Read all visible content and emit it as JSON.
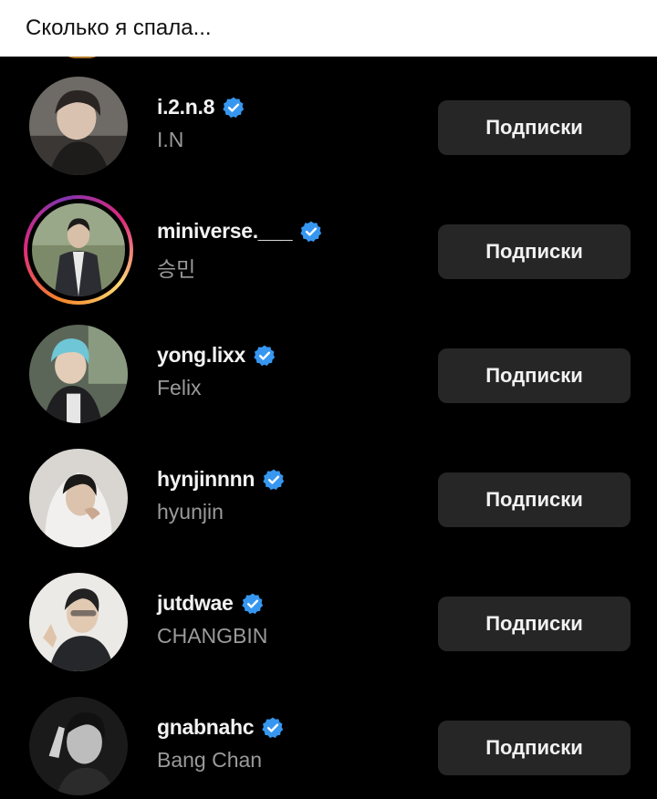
{
  "caption": "Сколько я спала...",
  "colors": {
    "verified": "#3797f0",
    "button_bg": "#262626",
    "name": "#9a9a9a"
  },
  "accounts": [
    {
      "handle": "i.2.n.8",
      "name": "I.N",
      "button": "Подписки",
      "verified": true,
      "story_ring": false,
      "avatar_icon": "profile-photo"
    },
    {
      "handle": "miniverse.___",
      "name": "승민",
      "button": "Подписки",
      "verified": true,
      "story_ring": true,
      "avatar_icon": "profile-photo"
    },
    {
      "handle": "yong.lixx",
      "name": "Felix",
      "button": "Подписки",
      "verified": true,
      "story_ring": false,
      "avatar_icon": "profile-photo"
    },
    {
      "handle": "hynjinnnn",
      "name": "hyunjin",
      "button": "Подписки",
      "verified": true,
      "story_ring": false,
      "avatar_icon": "profile-photo"
    },
    {
      "handle": "jutdwae",
      "name": "CHANGBIN",
      "button": "Подписки",
      "verified": true,
      "story_ring": false,
      "avatar_icon": "profile-photo"
    },
    {
      "handle": "gnabnahc",
      "name": "Bang Chan",
      "button": "Подписки",
      "verified": true,
      "story_ring": false,
      "avatar_icon": "profile-photo"
    }
  ]
}
